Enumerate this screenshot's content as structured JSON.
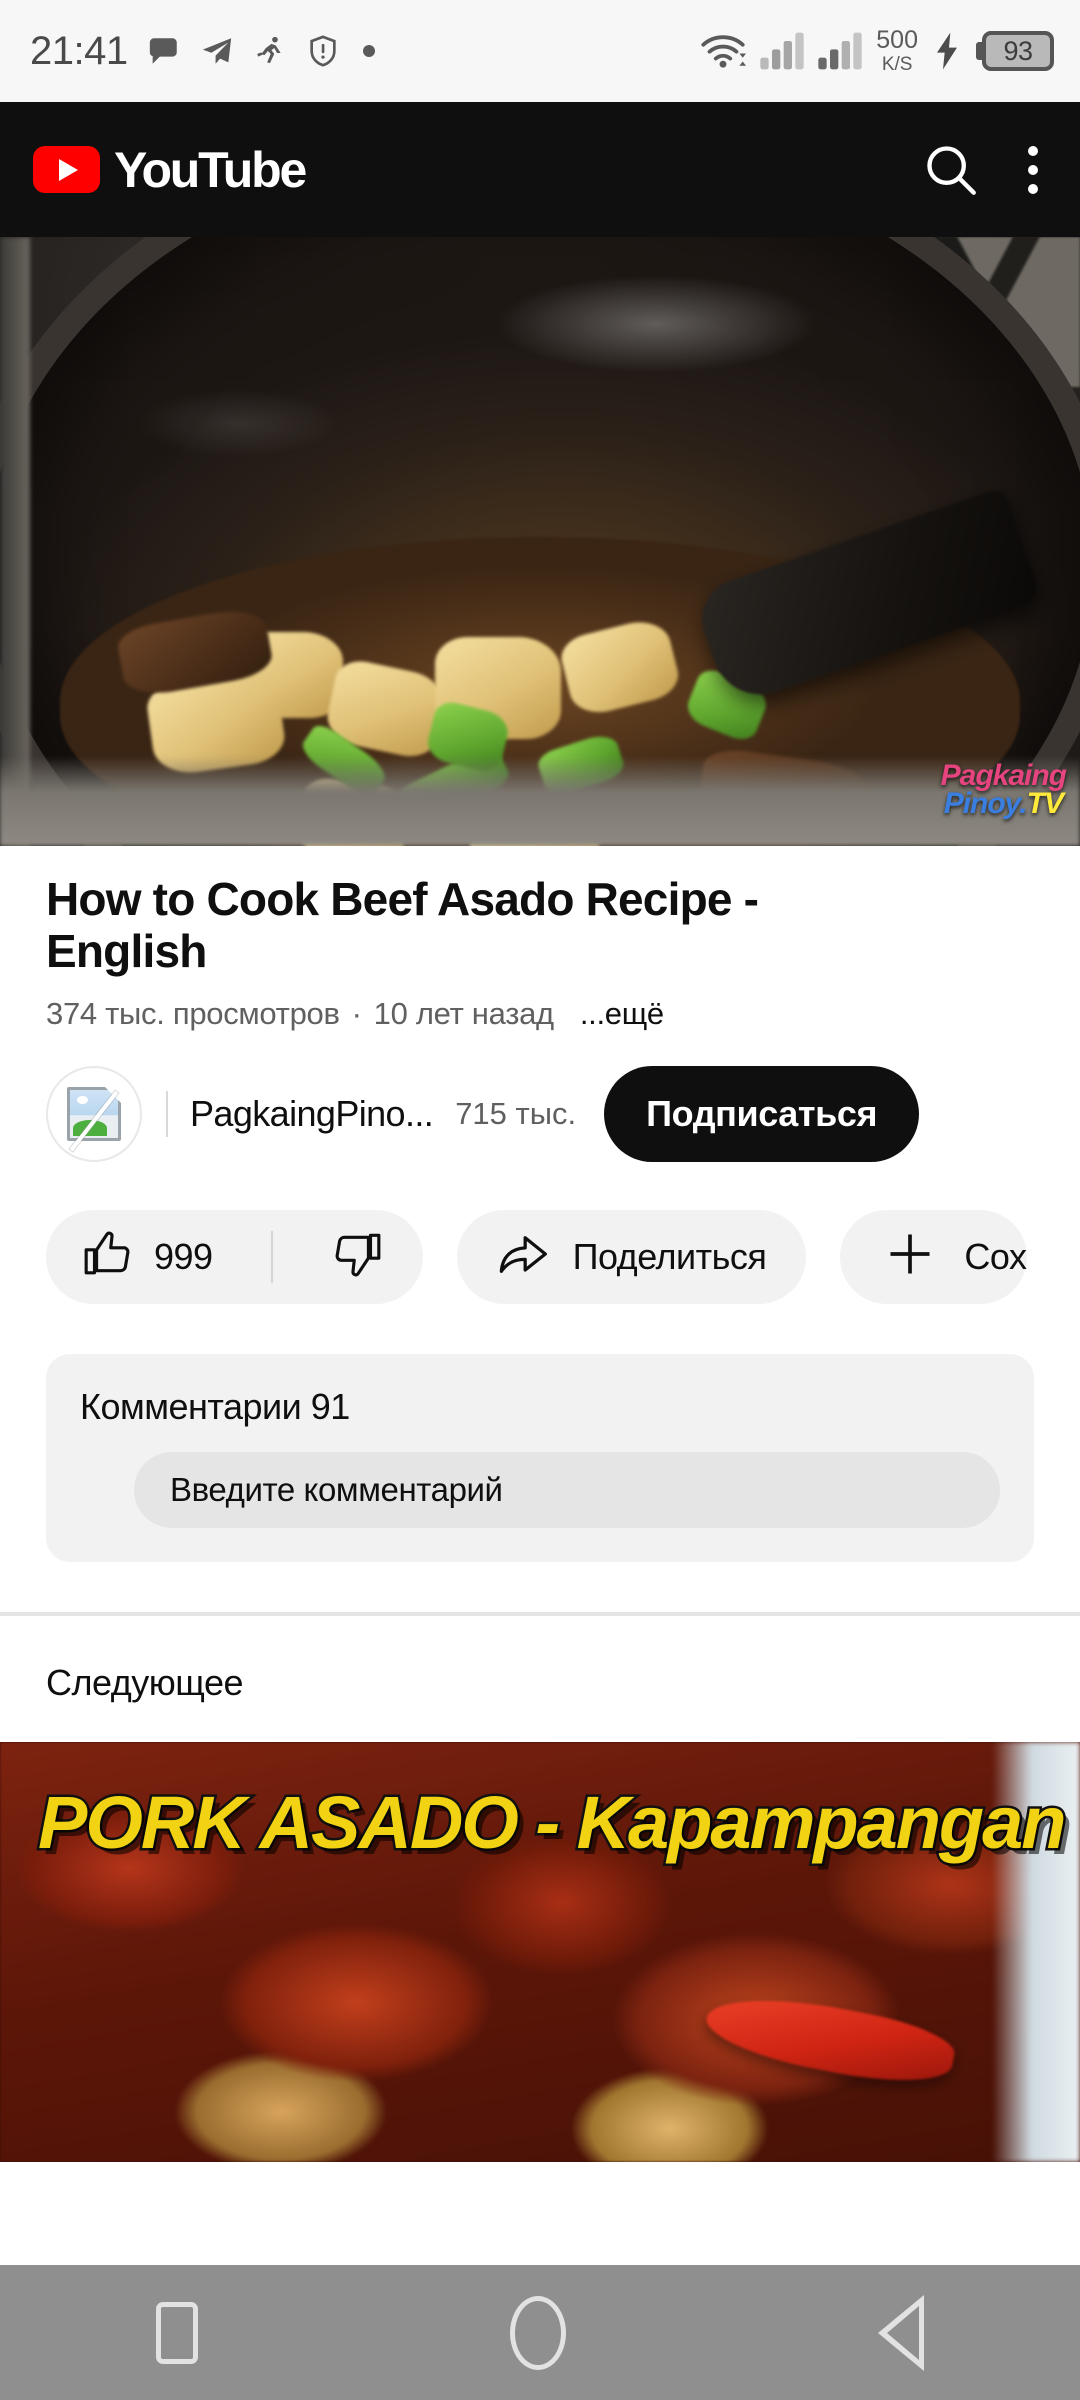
{
  "status_bar": {
    "time": "21:41",
    "left_icons": [
      "message-bubble-icon",
      "telegram-icon",
      "running-person-icon",
      "shield-warning-icon",
      "dot-icon"
    ],
    "network_speed_value": "500",
    "network_speed_unit": "K/S",
    "battery_percent": "93",
    "right_icons": [
      "wifi-icon",
      "signal-bars-icon",
      "signal-bars-icon",
      "charging-bolt-icon",
      "battery-icon"
    ]
  },
  "header": {
    "brand": "YouTube",
    "search_icon": "search-icon",
    "overflow_icon": "more-vertical-icon",
    "brand_color": "#ff0000",
    "background_color": "#0f0f0f"
  },
  "player": {
    "watermark_line1": "Pagkaing",
    "watermark_line2_blue": "Pinoy.",
    "watermark_line2_yellow": "TV"
  },
  "video": {
    "title": "How to Cook Beef Asado Recipe - English",
    "views": "374 тыс. просмотров",
    "separator": "·",
    "age": "10 лет назад",
    "more_label": "...ещё"
  },
  "channel": {
    "avatar_icon": "broken-image-icon",
    "name": "PagkaingPino...",
    "subscribers": "715 тыс.",
    "subscribe_label": "Подписаться"
  },
  "actions": {
    "like_icon": "thumbs-up-icon",
    "like_count": "999",
    "dislike_icon": "thumbs-down-icon",
    "share_icon": "share-arrow-icon",
    "share_label": "Поделиться",
    "save_icon": "plus-icon",
    "save_label": "Сох"
  },
  "comments": {
    "title": "Комментарии 91",
    "input_placeholder": "Введите комментарий"
  },
  "up_next": {
    "section_title": "Следующее",
    "thumbnail_text": "PORK ASADO - Kapampangan"
  },
  "nav_bar": {
    "recents_icon": "square-recents-icon",
    "home_icon": "circle-home-icon",
    "back_icon": "triangle-back-icon",
    "background_color": "#8f8f8f"
  }
}
